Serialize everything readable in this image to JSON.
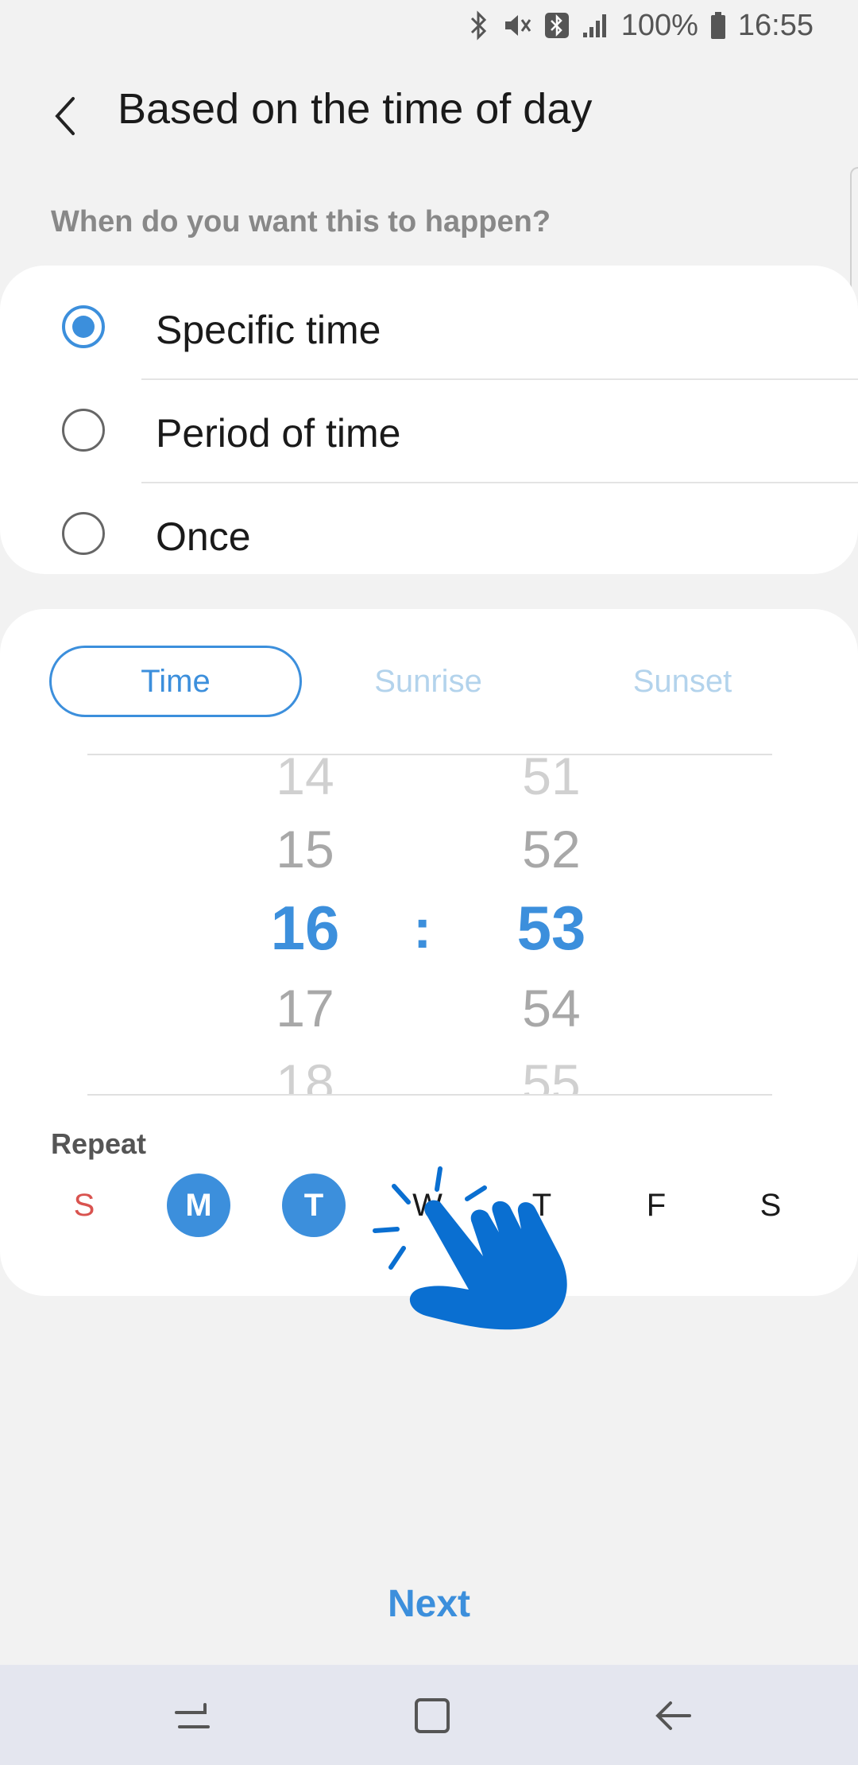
{
  "status_bar": {
    "battery": "100%",
    "time": "16:55"
  },
  "header": {
    "title": "Based on the time of day"
  },
  "question": "When do you want this to happen?",
  "options": [
    {
      "label": "Specific time",
      "checked": true
    },
    {
      "label": "Period of time",
      "checked": false
    },
    {
      "label": "Once",
      "checked": false
    }
  ],
  "time_tabs": [
    {
      "label": "Time",
      "active": true
    },
    {
      "label": "Sunrise",
      "active": false
    },
    {
      "label": "Sunset",
      "active": false
    }
  ],
  "picker": {
    "hours": [
      "14",
      "15",
      "16",
      "17",
      "18"
    ],
    "separator": ":",
    "minutes": [
      "51",
      "52",
      "53",
      "54",
      "55"
    ]
  },
  "repeat": {
    "label": "Repeat",
    "days": [
      {
        "label": "S",
        "selected": false
      },
      {
        "label": "M",
        "selected": true
      },
      {
        "label": "T",
        "selected": true
      },
      {
        "label": "W",
        "selected": false
      },
      {
        "label": "T",
        "selected": false
      },
      {
        "label": "F",
        "selected": false
      },
      {
        "label": "S",
        "selected": false
      }
    ]
  },
  "footer": {
    "next_label": "Next"
  },
  "colors": {
    "accent": "#3c8fdc",
    "sunday": "#d9534f",
    "background": "#f2f2f2",
    "hand": "#0a6fd1"
  }
}
